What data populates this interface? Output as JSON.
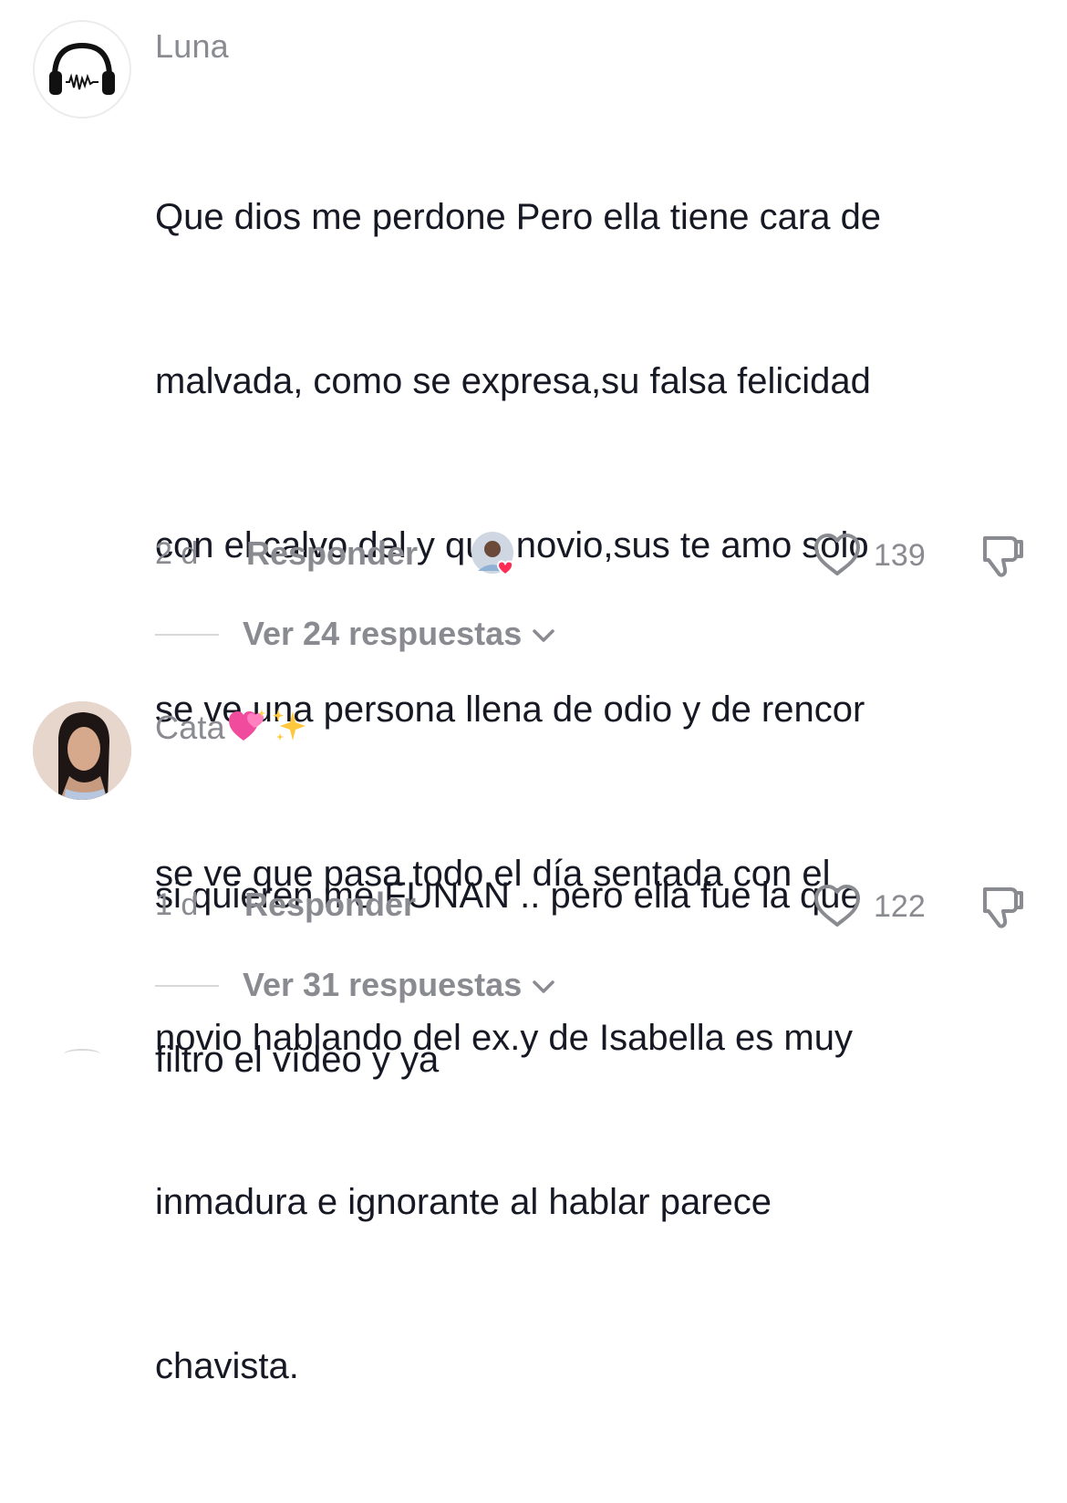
{
  "comments": [
    {
      "username": "Luna",
      "username_emojis": [],
      "avatar_icon": "headphones-icon",
      "text": "Que dios me perdone Pero ella tiene cara de malvada, como se expresa,su falsa felicidad con el calvo del y que novio,sus te amo solo se ve una persona llena de odio y de rencor se ve que pasa todo el día sentada con el novio hablando del ex.y de Isabella es muy inmadura e ignorante al hablar parece chavista.",
      "lines": [
        "Que dios me perdone Pero ella tiene cara de",
        "malvada, como se expresa,su falsa felicidad",
        "con el calvo del y que novio,sus te amo solo",
        "se ve una persona llena de odio y de rencor",
        "se ve que pasa todo el día sentada con el",
        "novio hablando del ex.y de Isabella es muy",
        "inmadura e ignorante al hablar parece",
        "chavista."
      ],
      "time": "2 d",
      "reply_label": "Responder",
      "creator_liked": true,
      "likes": "139",
      "view_replies": "Ver 24 respuestas"
    },
    {
      "username": "Cata",
      "username_emojis": [
        "sparkling-heart-icon",
        "sparkles-icon"
      ],
      "avatar_icon": "profile-photo",
      "lines": [
        "si quieren me FUNAN .. pero ella fue la que",
        "filtro el vídeo y ya"
      ],
      "time": "1 d",
      "reply_label": "Responder",
      "creator_liked": false,
      "likes": "122",
      "view_replies": "Ver 31 respuestas"
    }
  ],
  "colors": {
    "text": "#161823",
    "secondary": "#8a8b91",
    "divider": "#d8d8da",
    "heart_red": "#fe2c55"
  }
}
